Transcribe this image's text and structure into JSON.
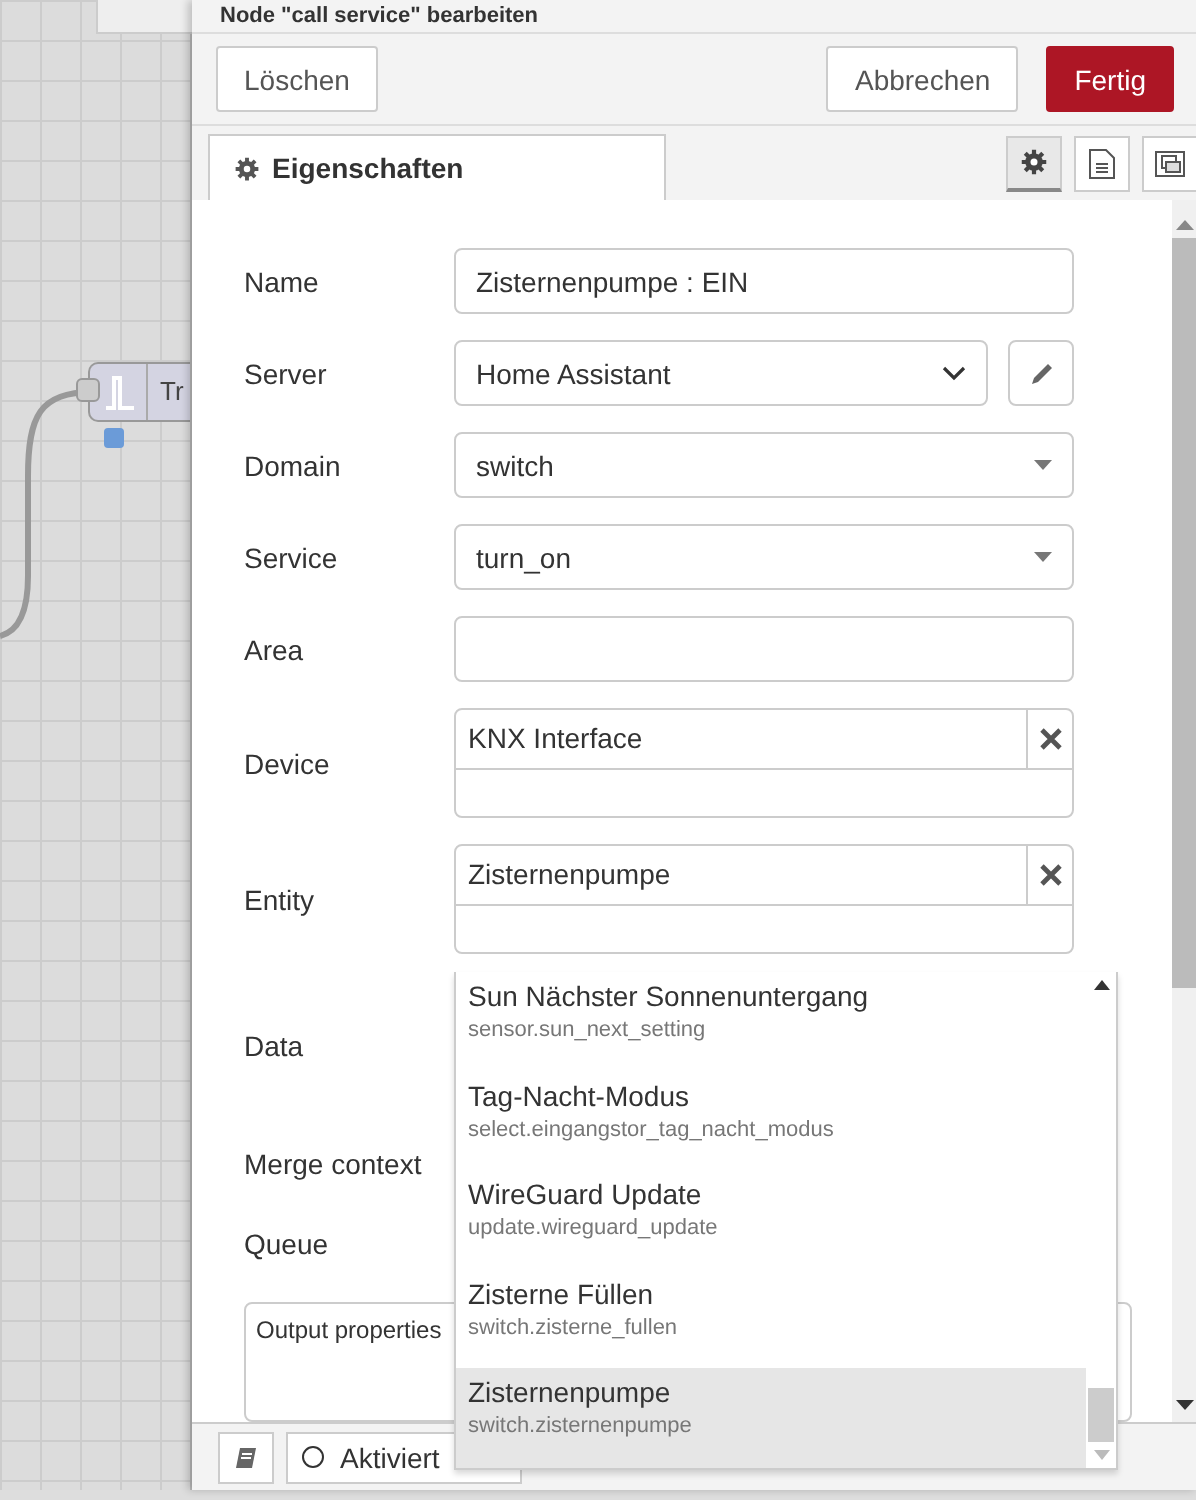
{
  "canvas": {
    "node": {
      "label": "Tr"
    }
  },
  "dialog": {
    "title": "Node \"call service\" bearbeiten",
    "buttons": [
      {
        "label": "Löschen",
        "kind": "secondary"
      },
      {
        "label": "Abbrechen",
        "kind": "secondary"
      },
      {
        "label": "Fertig",
        "kind": "primary"
      }
    ],
    "tabs": [
      {
        "label": "Eigenschaften",
        "selected": true
      }
    ],
    "side_tabs": [
      {
        "kind": "gear",
        "selected": true
      },
      {
        "kind": "document",
        "selected": false
      },
      {
        "kind": "frame",
        "selected": false
      }
    ],
    "fields": [
      {
        "label": "Name",
        "kind": "text",
        "value": "Zisternenpumpe : EIN"
      },
      {
        "label": "Server",
        "kind": "select",
        "value": "Home Assistant"
      },
      {
        "label": "Domain",
        "kind": "combo",
        "value": "switch"
      },
      {
        "label": "Service",
        "kind": "combo",
        "value": "turn_on"
      },
      {
        "label": "Area",
        "kind": "text"
      },
      {
        "label": "Device",
        "kind": "tags",
        "value": "KNX Interface"
      },
      {
        "label": "Entity",
        "kind": "tags",
        "value": "Zisternenpumpe"
      },
      {
        "label": "Data",
        "kind": "editor"
      },
      {
        "label": "Merge context",
        "kind": "blank"
      },
      {
        "label": "Queue",
        "kind": "blank"
      }
    ],
    "output_properties": {
      "label": "Output properties"
    },
    "dropdown": {
      "options": [
        {
          "name": "Sun Nächster Sonnenuntergang",
          "id": "sensor.sun_next_setting",
          "selected": false
        },
        {
          "name": "Tag-Nacht-Modus",
          "id": "select.eingangstor_tag_nacht_modus",
          "selected": false
        },
        {
          "name": "WireGuard Update",
          "id": "update.wireguard_update",
          "selected": false
        },
        {
          "name": "Zisterne Füllen",
          "id": "switch.zisterne_fullen",
          "selected": false
        },
        {
          "name": "Zisternenpumpe",
          "id": "switch.zisternenpumpe",
          "selected": true
        }
      ]
    },
    "footer": {
      "status": {
        "label": "Aktiviert",
        "on": false
      }
    }
  }
}
